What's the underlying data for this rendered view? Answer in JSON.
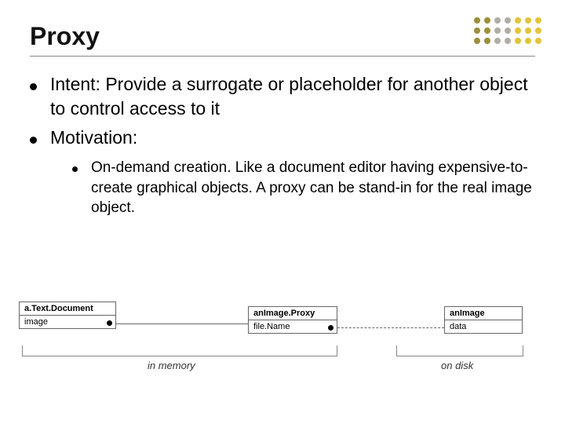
{
  "slide": {
    "title": "Proxy",
    "bullets": [
      "Intent: Provide a surrogate or placeholder for another object to control access to it",
      "Motivation:"
    ],
    "sub_bullet": "On-demand creation. Like a document editor having expensive-to-create graphical objects. A proxy can be stand-in for the real image object."
  },
  "diagram": {
    "boxes": [
      {
        "title": "a.Text.Document",
        "field": "image"
      },
      {
        "title": "anImage.Proxy",
        "field": "file.Name"
      },
      {
        "title": "anImage",
        "field": "data"
      }
    ],
    "regions": {
      "left": "in memory",
      "right": "on disk"
    }
  },
  "chart_data": {
    "type": "diagram",
    "title": "Proxy pattern object diagram",
    "nodes": [
      {
        "id": "doc",
        "label": "a.Text.Document",
        "attributes": [
          "image"
        ]
      },
      {
        "id": "proxy",
        "label": "anImage.Proxy",
        "attributes": [
          "file.Name"
        ]
      },
      {
        "id": "img",
        "label": "anImage",
        "attributes": [
          "data"
        ]
      }
    ],
    "edges": [
      {
        "from": "doc.image",
        "to": "proxy",
        "style": "solid"
      },
      {
        "from": "proxy.file.Name",
        "to": "img",
        "style": "dashed"
      }
    ],
    "groups": [
      {
        "label": "in memory",
        "members": [
          "doc",
          "proxy"
        ]
      },
      {
        "label": "on disk",
        "members": [
          "img"
        ]
      }
    ]
  }
}
